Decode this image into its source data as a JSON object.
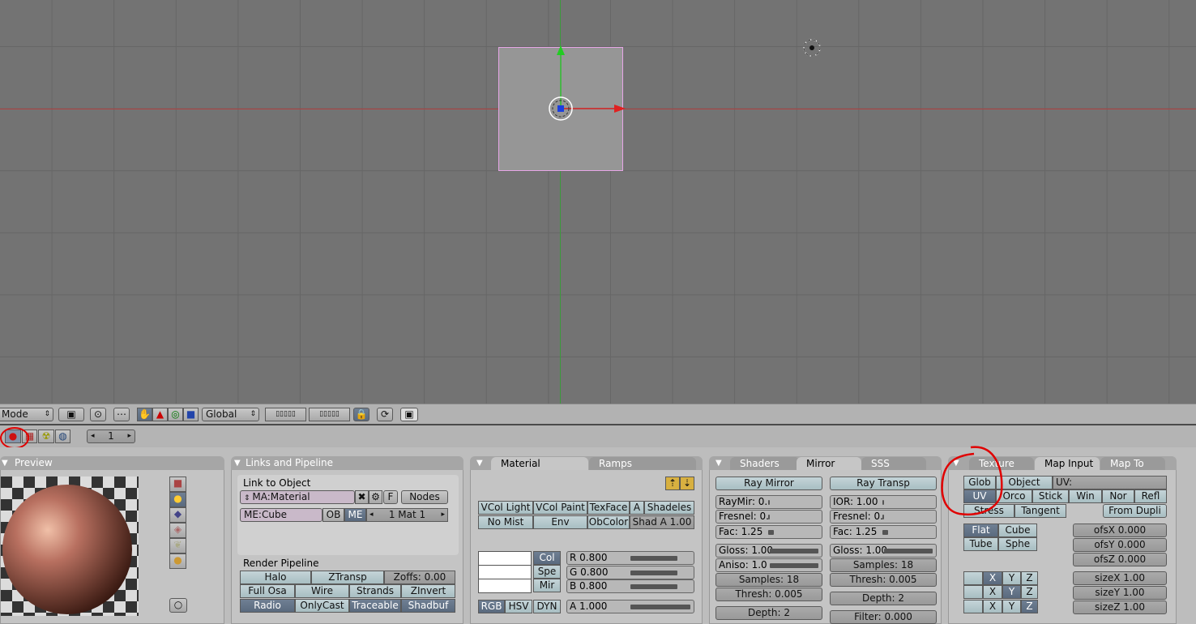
{
  "header": {
    "mode": "Mode",
    "orientation": "Global"
  },
  "frame": {
    "value": "1"
  },
  "preview": {
    "title": "Preview"
  },
  "links": {
    "title": "Links and Pipeline",
    "link_label": "Link to Object",
    "material_name": "MA:Material",
    "f_label": "F",
    "nodes_label": "Nodes",
    "mesh_name": "ME:Cube",
    "ob_label": "OB",
    "me_label": "ME",
    "mat_index": "1 Mat 1",
    "render_pipeline": "Render Pipeline",
    "halo": "Halo",
    "ztransp": "ZTransp",
    "zoffs": "Zoffs: 0.00",
    "full_osa": "Full Osa",
    "wire": "Wire",
    "strands": "Strands",
    "zinvert": "ZInvert",
    "radio": "Radio",
    "onlycast": "OnlyCast",
    "traceable": "Traceable",
    "shadbuf": "Shadbuf"
  },
  "material": {
    "tab_material": "Material",
    "tab_ramps": "Ramps",
    "vcol_light": "VCol Light",
    "vcol_paint": "VCol Paint",
    "texface": "TexFace",
    "a": "A",
    "shadeless": "Shadeles",
    "no_mist": "No Mist",
    "env": "Env",
    "obcolor": "ObColor",
    "shad_a": "Shad A 1.00",
    "col": "Col",
    "spe": "Spe",
    "mir": "Mir",
    "r": "R 0.800",
    "g": "G 0.800",
    "b": "B 0.800",
    "rgb": "RGB",
    "hsv": "HSV",
    "dyn": "DYN",
    "alpha": "A 1.000"
  },
  "shaders": {
    "tab_shaders": "Shaders",
    "tab_mirror": "Mirror Trans",
    "tab_sss": "SSS",
    "ray_mirror": "Ray Mirror",
    "ray_transp": "Ray Transp",
    "raymir": "RayMir: 0.",
    "fresnel1": "Fresnel: 0.",
    "fac1": "Fac: 1.25",
    "ior": "IOR: 1.00",
    "fresnel2": "Fresnel: 0.",
    "fac2": "Fac: 1.25",
    "gloss1": "Gloss: 1.00",
    "aniso": "Aniso: 1.0",
    "samples1": "Samples: 18",
    "thresh1": "Thresh: 0.005",
    "depth1": "Depth: 2",
    "gloss2": "Gloss: 1.00",
    "samples2": "Samples: 18",
    "thresh2": "Thresh: 0.005",
    "depth2": "Depth: 2",
    "filter": "Filter: 0.000"
  },
  "texture": {
    "tab_texture": "Texture",
    "tab_mapinput": "Map Input",
    "tab_mapto": "Map To",
    "glob": "Glob",
    "object": "Object",
    "uv_label": "UV:",
    "uv": "UV",
    "orco": "Orco",
    "stick": "Stick",
    "win": "Win",
    "nor": "Nor",
    "refl": "Refl",
    "stress": "Stress",
    "tangent": "Tangent",
    "from_dupli": "From Dupli",
    "flat": "Flat",
    "cube": "Cube",
    "tube": "Tube",
    "sphe": "Sphe",
    "ofsx": "ofsX 0.000",
    "ofsy": "ofsY 0.000",
    "ofsz": "ofsZ 0.000",
    "x": "X",
    "y": "Y",
    "z": "Z",
    "sizex": "sizeX 1.00",
    "sizey": "sizeY 1.00",
    "sizez": "sizeZ 1.00"
  },
  "colors": {
    "viewport": "#737373",
    "active_button": "#5a6a7e",
    "annotation_red": "#e00000"
  }
}
